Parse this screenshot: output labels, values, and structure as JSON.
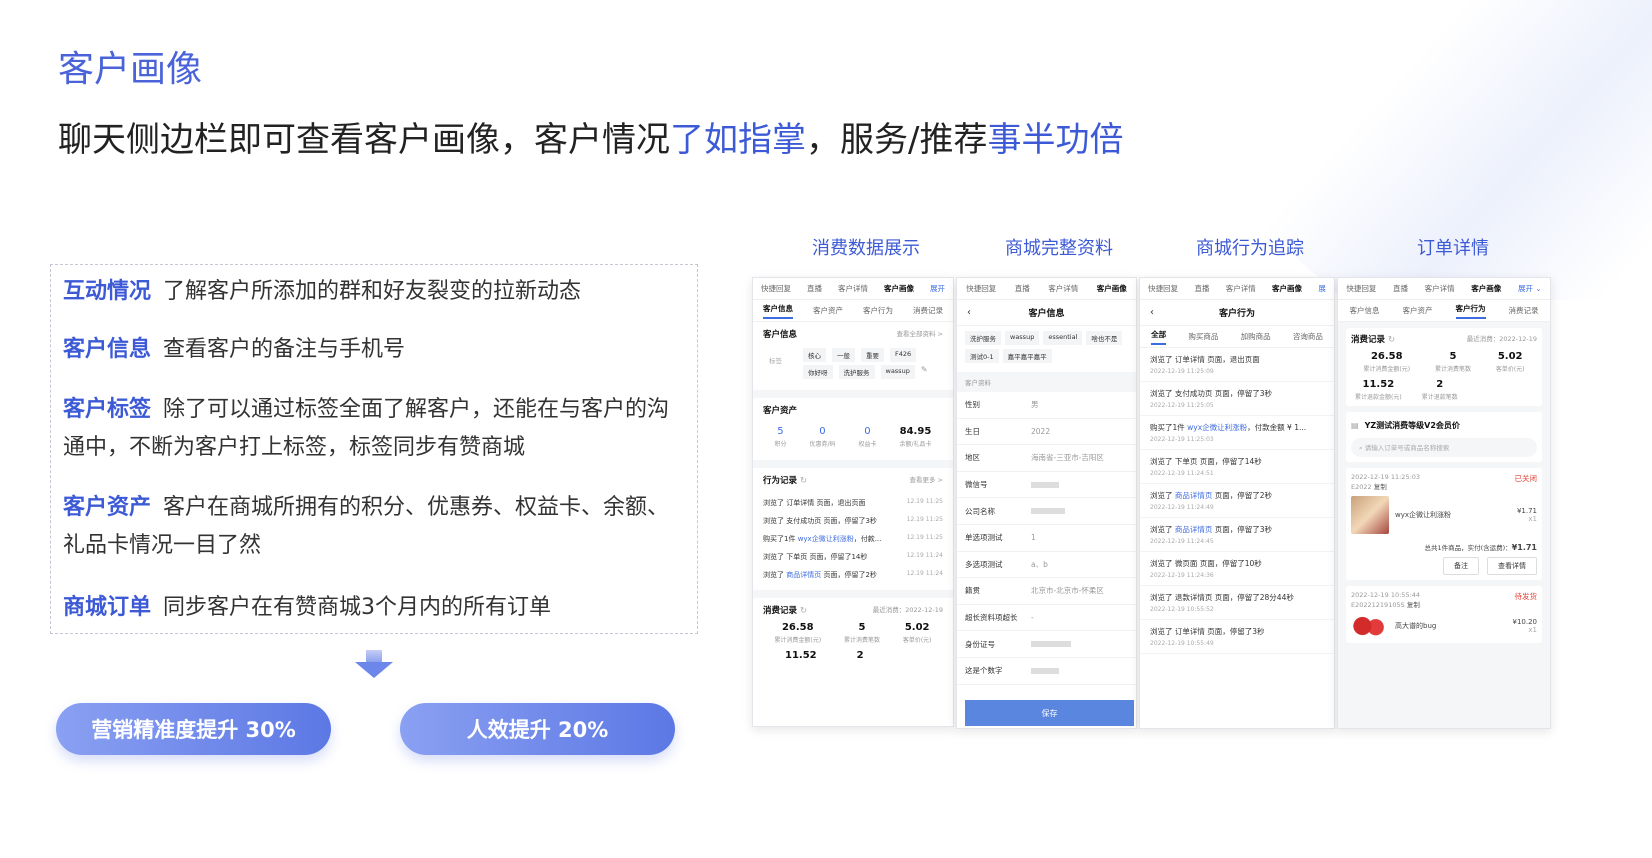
{
  "header": {
    "title": "客户画像",
    "subtitle_parts": [
      "聊天侧边栏即可查看客户画像，客户情况",
      "了如指掌",
      "，服务/推荐",
      "事半功倍"
    ]
  },
  "features": [
    {
      "key": "互动情况",
      "text": "了解客户所添加的群和好友裂变的拉新动态"
    },
    {
      "key": "客户信息",
      "text": "查看客户的备注与手机号"
    },
    {
      "key": "客户标签",
      "text": "除了可以通过标签全面了解客户，还能在与客户的沟通中，不断为客户打上标签，标签同步有赞商城"
    },
    {
      "key": "客户资产",
      "text": "客户在商城所拥有的积分、优惠券、权益卡、余额、礼品卡情况一目了然"
    },
    {
      "key": "商城订单",
      "text": "同步客户在有赞商城3个月内的所有订单"
    }
  ],
  "results": [
    "营销精准度提升 30%",
    "人效提升 20%"
  ],
  "captions": [
    "消费数据展示",
    "商城完整资料",
    "商城行为追踪",
    "订单详情"
  ],
  "phone_common": {
    "top_tabs": [
      "快捷回复",
      "直播",
      "客户详情",
      "客户画像"
    ],
    "expand": "展开",
    "sub_tabs": [
      "客户信息",
      "客户资产",
      "客户行为",
      "消费记录"
    ]
  },
  "phone1": {
    "info_title": "客户信息",
    "info_more": "查看全部资料 >",
    "tag_label": "标签",
    "tags": [
      "核心",
      "一般",
      "重要",
      "F426",
      "你好呀",
      "洗护服务",
      "wassup"
    ],
    "assets_title": "客户资产",
    "assets": [
      {
        "value": "5",
        "label": "积分"
      },
      {
        "value": "0",
        "label": "优惠券/码"
      },
      {
        "value": "0",
        "label": "权益卡"
      },
      {
        "value": "84.95",
        "label": "余额/礼品卡"
      }
    ],
    "log_title": "行为记录",
    "log_more": "查看更多 >",
    "logs": [
      {
        "pre": "浏览了 订单详情 页面，退出页面",
        "link": "",
        "post": "",
        "time": "12.19 11:25"
      },
      {
        "pre": "浏览了 支付成功页 页面，停留了3秒",
        "link": "",
        "post": "",
        "time": "12.19 11:25"
      },
      {
        "pre": "购买了1件 ",
        "link": "wyx企微让利涨粉",
        "post": "，付款...",
        "time": "12.19 11:25"
      },
      {
        "pre": "浏览了 下单页 页面，停留了14秒",
        "link": "",
        "post": "",
        "time": "12.19 11:24"
      },
      {
        "pre": "浏览了 ",
        "link": "商品详情页",
        "post": " 页面，停留了2秒",
        "time": "12.19 11:24"
      }
    ],
    "consume_title": "消费记录",
    "consume_recent": "最近消费：2022-12-19",
    "consume": [
      {
        "value": "26.58",
        "label": "累计消费金额(元)"
      },
      {
        "value": "5",
        "label": "累计消费笔数"
      },
      {
        "value": "5.02",
        "label": "客单价(元)"
      }
    ],
    "consume2": [
      "11.52",
      "2"
    ]
  },
  "phone2": {
    "title": "客户信息",
    "tags": [
      "洗护服务",
      "wassup",
      "essential",
      "啥也不是",
      "测试0-1",
      "嘉平嘉平嘉平"
    ],
    "section": "客户资料",
    "fields": [
      {
        "label": "性别",
        "value": "男"
      },
      {
        "label": "生日",
        "value": "2022"
      },
      {
        "label": "地区",
        "value": "海南省-三亚市-吉阳区"
      },
      {
        "label": "微信号",
        "value": ""
      },
      {
        "label": "公司名称",
        "value": ""
      },
      {
        "label": "单选项测试",
        "value": "1"
      },
      {
        "label": "多选项测试",
        "value": "a、b"
      },
      {
        "label": "籍贯",
        "value": "北京市-北京市-怀柔区"
      },
      {
        "label": "超长资料项超长",
        "value": "-"
      },
      {
        "label": "身份证号",
        "value": ""
      },
      {
        "label": "这是个数字",
        "value": ""
      }
    ],
    "save": "保存"
  },
  "phone3": {
    "title": "客户行为",
    "filters": [
      "全部",
      "购买商品",
      "加购商品",
      "咨询商品"
    ],
    "events": [
      {
        "pre": "浏览了 订单详情 页面，退出页面",
        "link": "",
        "post": "",
        "time": "2022-12-19 11:25:09"
      },
      {
        "pre": "浏览了 支付成功页 页面，停留了3秒",
        "link": "",
        "post": "",
        "time": "2022-12-19 11:25:05"
      },
      {
        "pre": "购买了1件 ",
        "link": "wyx企微让利涨粉",
        "post": "，付款金额 ¥ 1...",
        "time": "2022-12-19 11:25:03"
      },
      {
        "pre": "浏览了 下单页 页面，停留了14秒",
        "link": "",
        "post": "",
        "time": "2022-12-19 11:24:51"
      },
      {
        "pre": "浏览了 ",
        "link": "商品详情页",
        "post": " 页面，停留了2秒",
        "time": "2022-12-19 11:24:49"
      },
      {
        "pre": "浏览了 ",
        "link": "商品详情页",
        "post": " 页面，停留了3秒",
        "time": "2022-12-19 11:24:45"
      },
      {
        "pre": "浏览了 微页面 页面，停留了10秒",
        "link": "",
        "post": "",
        "time": "2022-12-19 11:24:36"
      },
      {
        "pre": "浏览了 退款详情页 页面，停留了28分44秒",
        "link": "",
        "post": "",
        "time": "2022-12-19 10:55:52"
      },
      {
        "pre": "浏览了 订单详情 页面，停留了3秒",
        "link": "",
        "post": "",
        "time": "2022-12-19 10:55:49"
      }
    ]
  },
  "phone4": {
    "consume_title": "消费记录",
    "recent": "最近消费：2022-12-19",
    "stats": [
      {
        "value": "26.58",
        "label": "累计消费金额(元)"
      },
      {
        "value": "5",
        "label": "累计消费笔数"
      },
      {
        "value": "5.02",
        "label": "客单价(元)"
      },
      {
        "value": "11.52",
        "label": "累计退款金额(元)"
      },
      {
        "value": "2",
        "label": "累计退款笔数"
      }
    ],
    "member": "YZ测试消费等级V2会员价",
    "search_placeholder": "请输入订单号或商品名称搜索",
    "orders": [
      {
        "time": "2022-12-19 11:25:03",
        "no": "E2022",
        "copy": "复制",
        "status": "已关闭",
        "product": "wyx企微让利涨粉",
        "price": "¥1.71",
        "qty": "x1",
        "summary": "总共1件商品，实付(含运费)：",
        "total": "¥1.71",
        "buttons": [
          "备注",
          "查看详情"
        ]
      },
      {
        "time": "2022-12-19 10:55:44",
        "no": "E20221219105S",
        "copy": "复制",
        "status": "待发货",
        "product": "高大谱的bug",
        "price": "¥10.20",
        "qty": "x1"
      }
    ]
  },
  "colors": {
    "accent": "#3d5ad6",
    "link": "#3d6be0",
    "status": "#e0443a"
  }
}
